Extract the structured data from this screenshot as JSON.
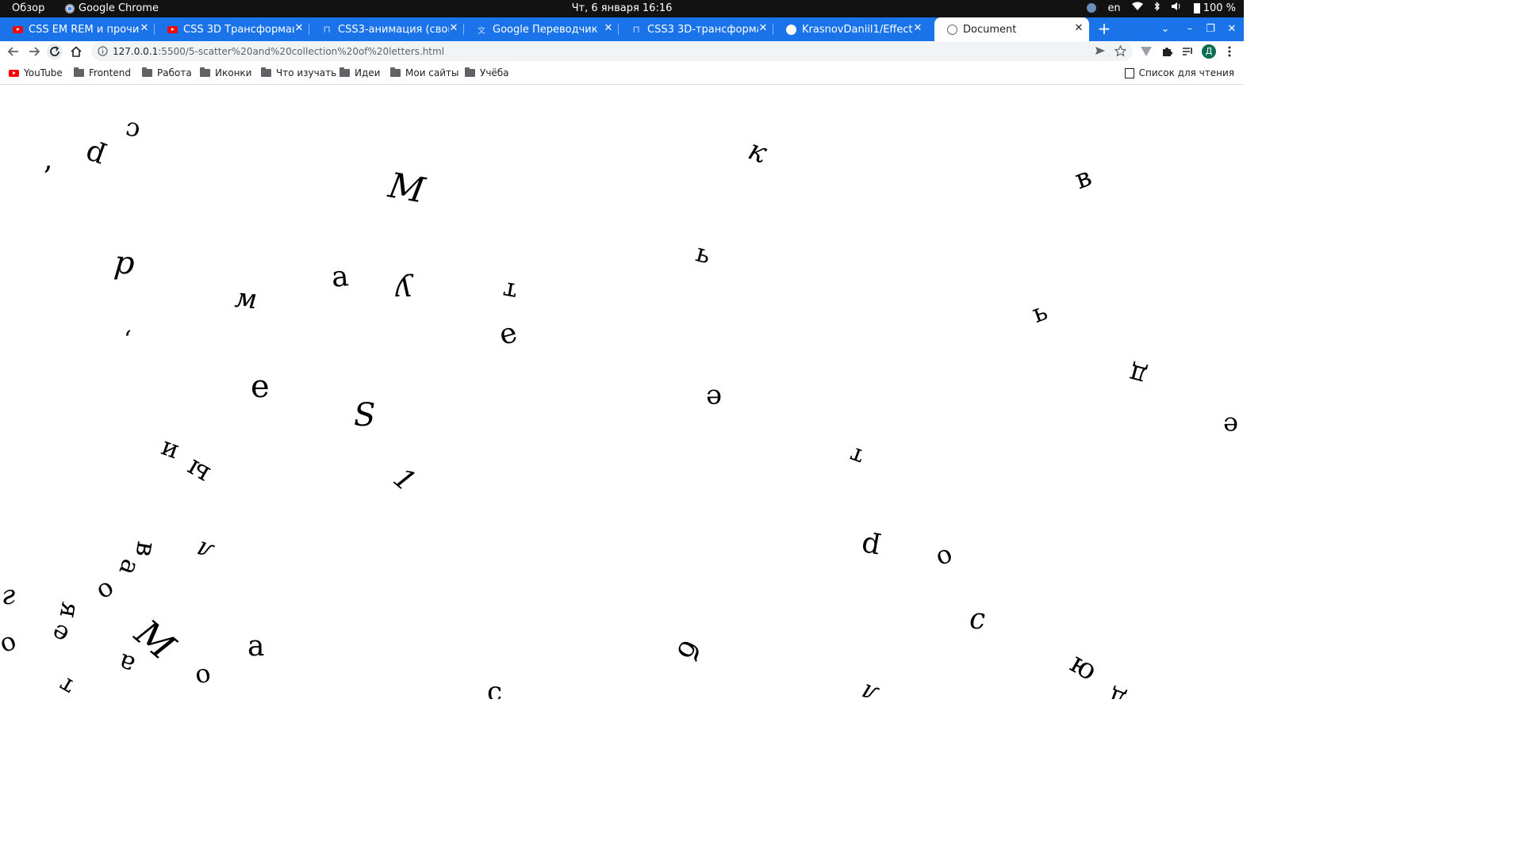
{
  "os": {
    "overview": "Обзор",
    "app_name": "Google Chrome",
    "clock": "Чт, 6 января  16:16",
    "lang": "en",
    "battery": "100 %"
  },
  "tabs": [
    {
      "title": "CSS EM REM и прочие ед",
      "favicon": "youtube-icon"
    },
    {
      "title": "CSS 3D Трансформации.",
      "favicon": "youtube-icon"
    },
    {
      "title": "CSS3-анимация (свойств",
      "favicon": "page-icon"
    },
    {
      "title": "Google Переводчик",
      "favicon": "translate-icon"
    },
    {
      "title": "CSS3 3D-трансформации",
      "favicon": "page-icon"
    },
    {
      "title": "KrasnovDaniil1/EffectsAn",
      "favicon": "github-icon"
    },
    {
      "title": "Document",
      "favicon": "globe-icon",
      "active": true
    }
  ],
  "address": {
    "host": "127.0.0.1",
    "path": ":5500/5-scatter%20and%20collection%20of%20letters.html"
  },
  "profile_initial": "Д",
  "bookmarks": [
    {
      "label": "YouTube",
      "icon": "youtube-icon"
    },
    {
      "label": "Frontend",
      "icon": "folder-icon"
    },
    {
      "label": "Работа",
      "icon": "folder-icon"
    },
    {
      "label": "Иконки",
      "icon": "folder-icon"
    },
    {
      "label": "Что изучать",
      "icon": "folder-icon"
    },
    {
      "label": "Идеи",
      "icon": "folder-icon"
    },
    {
      "label": "Мои сайты",
      "icon": "folder-icon"
    },
    {
      "label": "Учёба",
      "icon": "folder-icon"
    }
  ],
  "reading_list": "Список для чтения",
  "letters": [
    "с",
    "р",
    ",",
    "М",
    "к",
    "в",
    "р",
    "м",
    "а",
    "у",
    "т",
    "ь",
    "ь",
    "е",
    ",",
    "е",
    "е",
    "S",
    "д",
    "е",
    "и",
    "ы",
    "1",
    "т",
    "л",
    "в",
    "а",
    "о",
    "р",
    "о",
    "г",
    "е",
    "я",
    "М",
    "с",
    "о",
    "а",
    "а",
    "б",
    "ю",
    "о",
    "т",
    "с",
    "л",
    "д"
  ]
}
